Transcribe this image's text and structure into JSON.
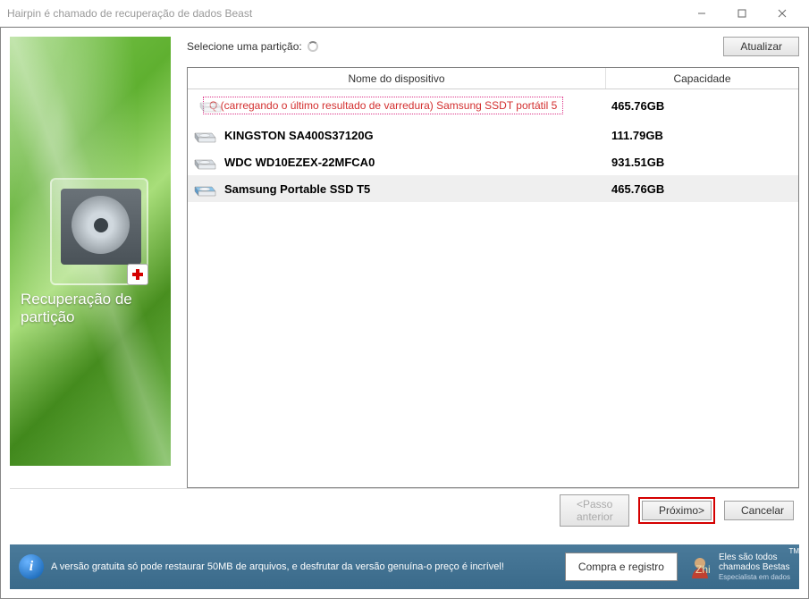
{
  "window": {
    "title": "Hairpin é chamado de recuperação de dados Beast"
  },
  "sidebar": {
    "label": "Recuperação de partição"
  },
  "top": {
    "select_label": "Selecione uma partição:",
    "refresh": "Atualizar"
  },
  "table": {
    "header_name": "Nome do dispositivo",
    "header_capacity": "Capacidade",
    "rows": [
      {
        "scan": true,
        "name": "Q (carregando o último resultado de varredura) Samsung SSDT portátil 5",
        "capacity": "465.76GB"
      },
      {
        "name": "KINGSTON SA400S37120G",
        "capacity": "111.79GB"
      },
      {
        "name": "WDC WD10EZEX-22MFCA0",
        "capacity": "931.51GB"
      },
      {
        "name": "Samsung Portable SSD T5",
        "capacity": "465.76GB",
        "selected": true,
        "blue": true
      }
    ]
  },
  "nav": {
    "prev": "<Passo anterior",
    "next": "Próximo>",
    "cancel": "Cancelar"
  },
  "footer": {
    "info": "A versão gratuita só pode restaurar 50MB de arquivos, e desfrutar da versão genuína-o preço é incrível!",
    "buy": "Compra e registro",
    "brand_line1": "Eles são todos",
    "brand_line2": "chamados Bestas",
    "brand_sub": "Especialista em dados",
    "brand_logo": "Zhi",
    "tm": "TM"
  }
}
